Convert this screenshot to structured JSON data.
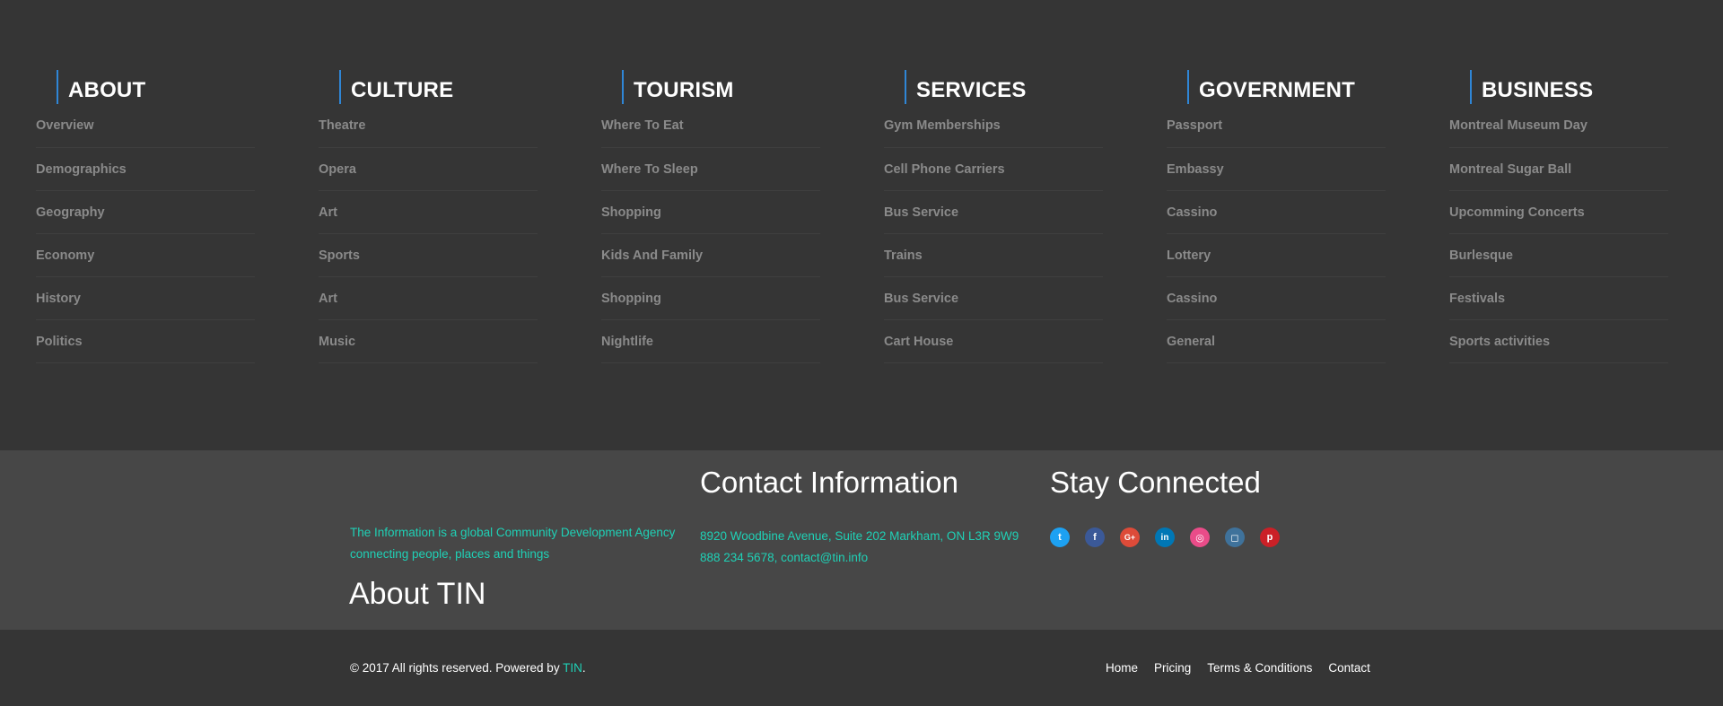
{
  "columns": [
    {
      "title": "ABOUT",
      "items": [
        "Overview",
        "Demographics",
        "Geography",
        "Economy",
        "History",
        "Politics"
      ]
    },
    {
      "title": "CULTURE",
      "items": [
        "Theatre",
        "Opera",
        "Art",
        "Sports",
        "Art",
        "Music"
      ]
    },
    {
      "title": "TOURISM",
      "items": [
        "Where To Eat",
        "Where To Sleep",
        "Shopping",
        "Kids And Family",
        "Shopping",
        "Nightlife"
      ]
    },
    {
      "title": "SERVICES",
      "items": [
        "Gym Memberships",
        "Cell Phone Carriers",
        "Bus Service",
        "Trains",
        "Bus Service",
        "Cart House"
      ]
    },
    {
      "title": "GOVERNMENT",
      "items": [
        "Passport",
        "Embassy",
        "Cassino",
        "Lottery",
        "Cassino",
        "General"
      ]
    },
    {
      "title": "BUSINESS",
      "items": [
        "Montreal Museum Day",
        "Montreal Sugar Ball",
        "Upcomming Concerts",
        "Burlesque",
        "Festivals",
        "Sports activities"
      ]
    }
  ],
  "about": {
    "description_line1": "The Information is a global Community Development Agency",
    "description_line2": "connecting people, places and things",
    "title": "About TIN"
  },
  "contact": {
    "title": "Contact Information",
    "address": "8920 Woodbine Avenue, Suite 202 Markham, ON L3R 9W9",
    "phone_email": "888 234 5678, contact@tin.info"
  },
  "stay": {
    "title": "Stay Connected"
  },
  "social": [
    {
      "name": "twitter-icon",
      "glyph": "t",
      "color": "#1da1f2"
    },
    {
      "name": "facebook-icon",
      "glyph": "f",
      "color": "#3b5998"
    },
    {
      "name": "google-plus-icon",
      "glyph": "G+",
      "color": "#dd4b39"
    },
    {
      "name": "linkedin-icon",
      "glyph": "in",
      "color": "#0077b5"
    },
    {
      "name": "dribbble-icon",
      "glyph": "◎",
      "color": "#ea4c89"
    },
    {
      "name": "instagram-icon",
      "glyph": "◻",
      "color": "#3f729b"
    },
    {
      "name": "pinterest-icon",
      "glyph": "p",
      "color": "#cb2027"
    }
  ],
  "footer": {
    "copyright_prefix": "© 2017 All rights reserved. Powered by ",
    "brand": "TIN",
    "copyright_suffix": ".",
    "nav": [
      "Home",
      "Pricing",
      "Terms & Conditions",
      "Contact"
    ]
  }
}
